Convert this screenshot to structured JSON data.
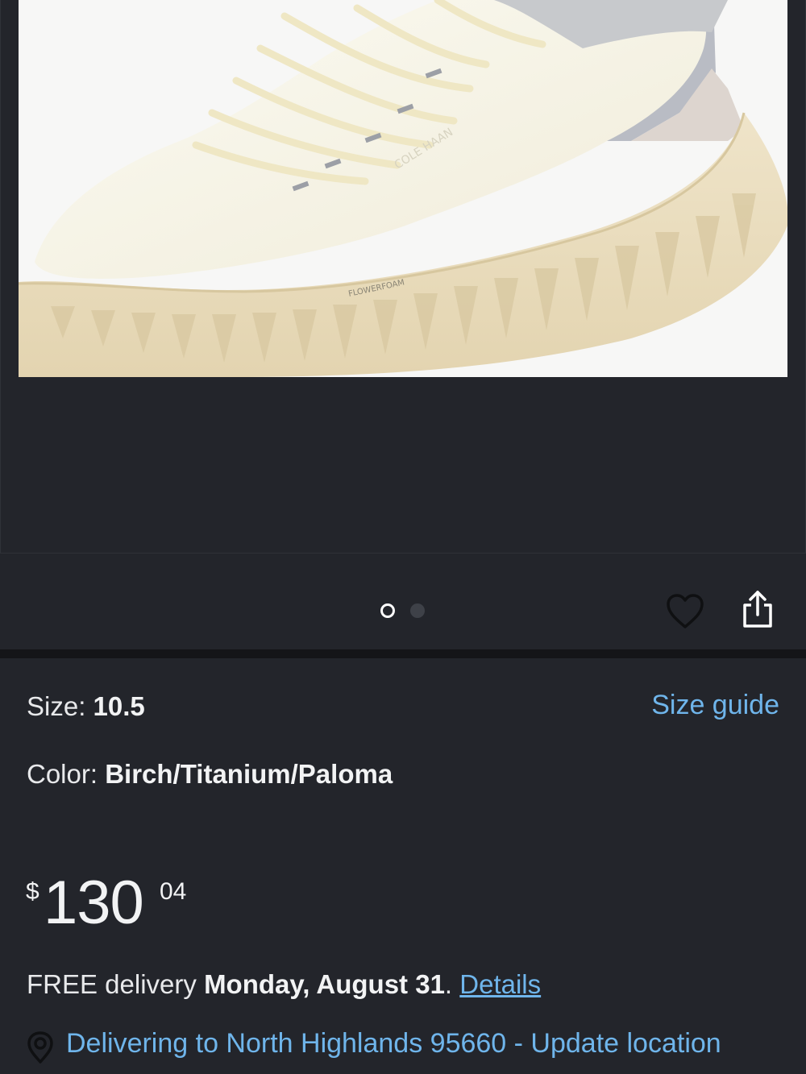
{
  "product": {
    "image_alt": "Shoe product image",
    "brand_text": "COLE HAAN",
    "midsole_text": "FLOWERFOAM"
  },
  "gallery": {
    "dots_total": 2,
    "active_index": 0
  },
  "icons": {
    "wishlist": "heart-icon",
    "share": "share-icon",
    "location": "location-pin-icon"
  },
  "details": {
    "size_label": "Size: ",
    "size_value": "10.5",
    "size_guide_link": "Size guide",
    "color_label": "Color: ",
    "color_value": "Birch/Titanium/Paloma"
  },
  "price": {
    "currency": "$",
    "whole": "130",
    "fraction": "04"
  },
  "delivery": {
    "prefix": "FREE delivery ",
    "date": "Monday, August 31",
    "suffix": ". ",
    "details_link": "Details"
  },
  "location": {
    "text": "Delivering to North Highlands 95660 - Update location"
  },
  "colors": {
    "background": "#23252b",
    "link": "#6fb5eb",
    "text": "#e8e9eb"
  }
}
